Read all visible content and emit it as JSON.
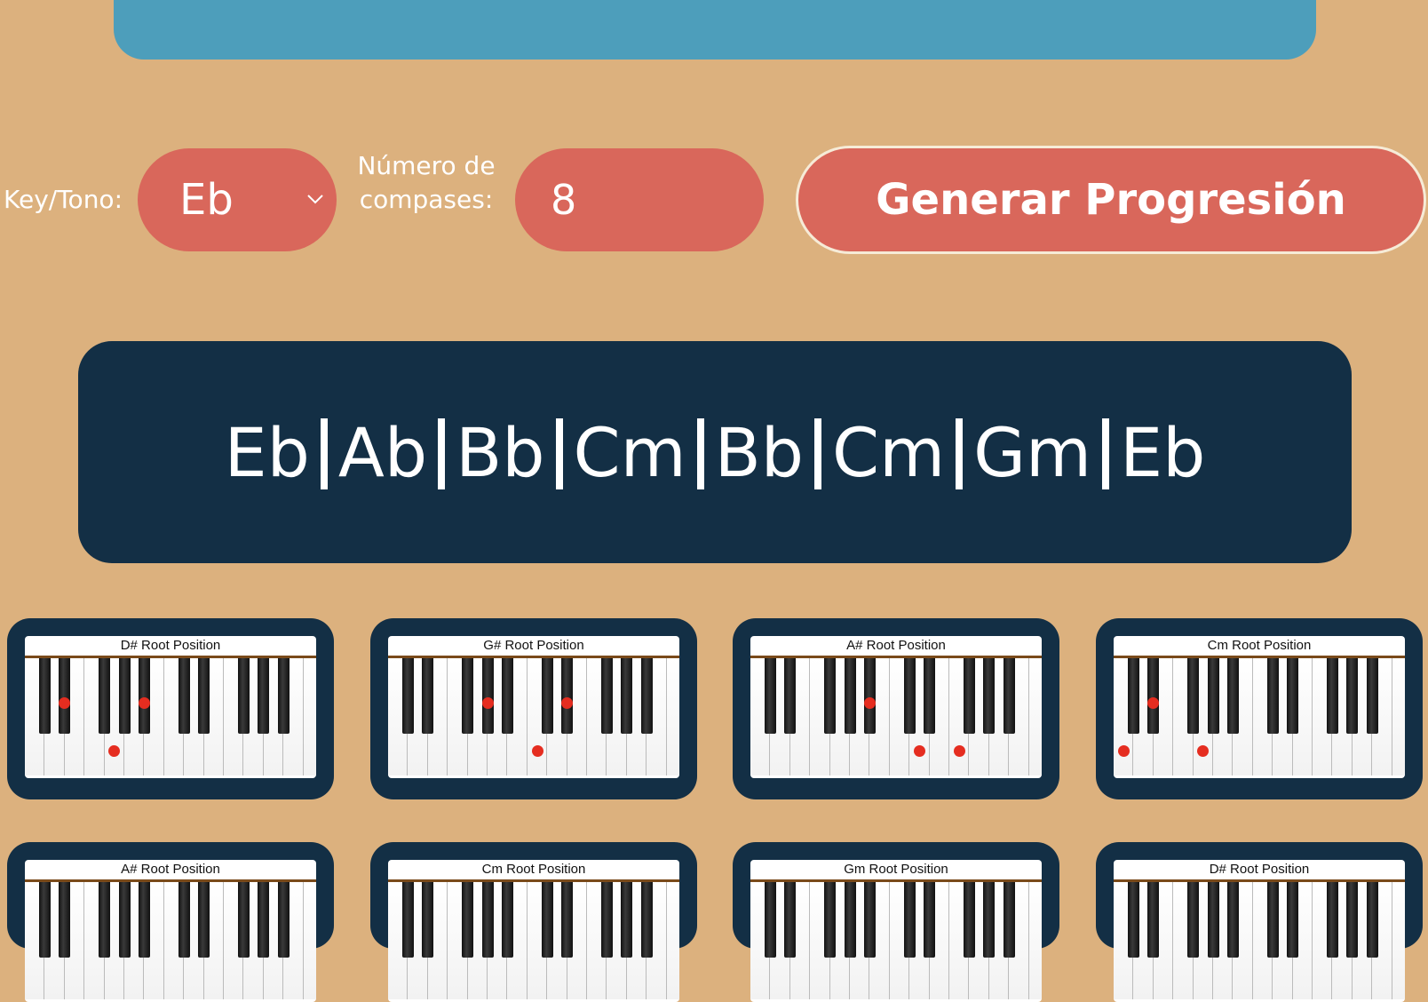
{
  "controls": {
    "key_label": "Key/Tono:",
    "key_value": "Eb",
    "measures_label": "Número de compases:",
    "measures_value": "8",
    "generate_label": "Generar Progresión"
  },
  "progression": {
    "chords": [
      "Eb",
      "Ab",
      "Bb",
      "Cm",
      "Bb",
      "Cm",
      "Gm",
      "Eb"
    ]
  },
  "chord_cards": [
    {
      "title": "D# Root Position",
      "notes": [
        "D#",
        "G",
        "A#"
      ]
    },
    {
      "title": "G# Root Position",
      "notes": [
        "G#",
        "C",
        "D#"
      ]
    },
    {
      "title": "A# Root Position",
      "notes": [
        "A#",
        "D",
        "F"
      ]
    },
    {
      "title": "Cm Root Position",
      "notes": [
        "C",
        "D#",
        "G"
      ]
    },
    {
      "title": "A# Root Position",
      "notes": []
    },
    {
      "title": "Cm Root Position",
      "notes": []
    },
    {
      "title": "Gm Root Position",
      "notes": []
    },
    {
      "title": "D# Root Position",
      "notes": []
    }
  ],
  "colors": {
    "background": "#DCB17E",
    "banner": "#4D9EBB",
    "control_fill": "#D9675B",
    "panel": "#132F45",
    "note_dot": "#E52D20"
  }
}
